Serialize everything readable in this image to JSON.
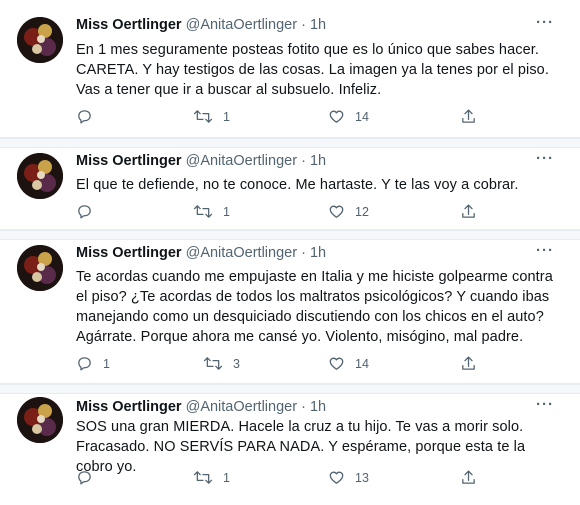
{
  "tweets": [
    {
      "name": "Miss Oertlinger",
      "handle": "@AnitaOertlinger",
      "dot": "·",
      "time": "1h",
      "text": "En 1 mes seguramente posteas fotito que es lo único que sabes hacer. CARETA. Y hay testigos de las cosas. La imagen ya la tenes por el piso. Vas a tener que ir a buscar al subsuelo. Infeliz.",
      "replies": "",
      "retweets": "1",
      "likes": "14"
    },
    {
      "name": "Miss Oertlinger",
      "handle": "@AnitaOertlinger",
      "dot": "·",
      "time": "1h",
      "text": "El que te defiende, no te conoce. Me hartaste. Y te las voy a cobrar.",
      "replies": "",
      "retweets": "1",
      "likes": "12"
    },
    {
      "name": "Miss Oertlinger",
      "handle": "@AnitaOertlinger",
      "dot": "·",
      "time": "1h",
      "text": "Te acordas cuando me empujaste en Italia y me hiciste golpearme contra el piso? ¿Te acordas de todos los maltratos psicológicos? Y cuando ibas manejando como un desquiciado discutiendo con los chicos en el auto? Agárrate. Porque ahora me cansé yo. Violento, misógino, mal padre.",
      "replies": "1",
      "retweets": "3",
      "likes": "14"
    },
    {
      "name": "Miss Oertlinger",
      "handle": "@AnitaOertlinger",
      "dot": "·",
      "time": "1h",
      "text": "SOS una gran MIERDA. Hacele la cruz a tu hijo. Te vas a morir solo. Fracasado. NO SERVÍS PARA NADA. Y espérame, porque esta te la cobro yo.",
      "replies": "",
      "retweets": "1",
      "likes": "13"
    }
  ],
  "icons": {
    "reply": "reply-icon",
    "retweet": "retweet-icon",
    "like": "heart-icon",
    "share": "share-icon",
    "more": "more-icon"
  },
  "colors": {
    "text": "#0f1419",
    "meta": "#536471",
    "divider": "#e6ecf0",
    "separator": "#f5f8fa"
  }
}
